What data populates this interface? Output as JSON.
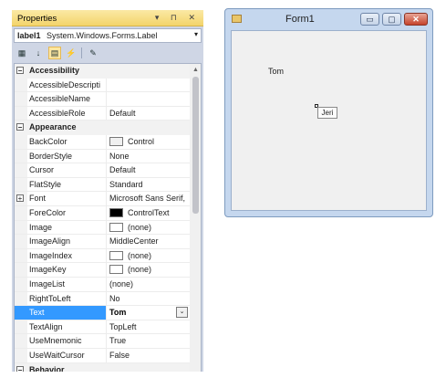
{
  "properties_panel": {
    "title": "Properties",
    "title_buttons": "▾ ⊓ ✕",
    "object_name": "label1",
    "object_type": "System.Windows.Forms.Label",
    "toolbar_icons": [
      "categorized-icon",
      "alphabetical-icon",
      "properties-icon",
      "events-icon",
      "property-pages-icon"
    ],
    "rows": [
      {
        "kind": "cat",
        "label": "Accessibility",
        "exp": "⊟"
      },
      {
        "kind": "prop",
        "name": "AccessibleDescripti",
        "value": ""
      },
      {
        "kind": "prop",
        "name": "AccessibleName",
        "value": ""
      },
      {
        "kind": "prop",
        "name": "AccessibleRole",
        "value": "Default"
      },
      {
        "kind": "cat",
        "label": "Appearance",
        "exp": "⊟"
      },
      {
        "kind": "prop",
        "name": "BackColor",
        "value": "Control",
        "swatch": "#f0f0f0"
      },
      {
        "kind": "prop",
        "name": "BorderStyle",
        "value": "None"
      },
      {
        "kind": "prop",
        "name": "Cursor",
        "value": "Default"
      },
      {
        "kind": "prop",
        "name": "FlatStyle",
        "value": "Standard"
      },
      {
        "kind": "prop",
        "name": "Font",
        "value": "Microsoft Sans Serif,",
        "expand": "+"
      },
      {
        "kind": "prop",
        "name": "ForeColor",
        "value": "ControlText",
        "swatch": "#000000"
      },
      {
        "kind": "prop",
        "name": "Image",
        "value": "(none)",
        "swatch": "#ffffff"
      },
      {
        "kind": "prop",
        "name": "ImageAlign",
        "value": "MiddleCenter"
      },
      {
        "kind": "prop",
        "name": "ImageIndex",
        "value": "(none)",
        "swatch": "#ffffff"
      },
      {
        "kind": "prop",
        "name": "ImageKey",
        "value": "(none)",
        "swatch": "#ffffff"
      },
      {
        "kind": "prop",
        "name": "ImageList",
        "value": "(none)"
      },
      {
        "kind": "prop",
        "name": "RightToLeft",
        "value": "No"
      },
      {
        "kind": "prop",
        "name": "Text",
        "value": "Tom",
        "selected": true
      },
      {
        "kind": "prop",
        "name": "TextAlign",
        "value": "TopLeft"
      },
      {
        "kind": "prop",
        "name": "UseMnemonic",
        "value": "True"
      },
      {
        "kind": "prop",
        "name": "UseWaitCursor",
        "value": "False"
      },
      {
        "kind": "cat",
        "label": "Behavior",
        "exp": "⊟"
      }
    ]
  },
  "form_window": {
    "title": "Form1",
    "min_glyph": "▭",
    "max_glyph": "▢",
    "close_glyph": "✕",
    "label_text": "Tom",
    "button_text": "Jeri"
  },
  "colors": {
    "selection": "#3399ff",
    "titlebar": "#f3d46b"
  }
}
